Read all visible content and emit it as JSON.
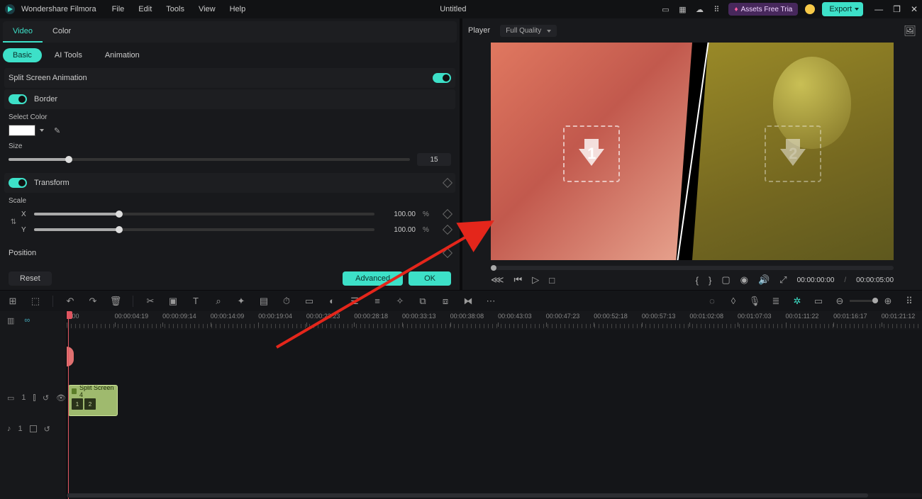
{
  "app": {
    "brand": "Wondershare Filmora",
    "doc_title": "Untitled"
  },
  "menus": [
    "File",
    "Edit",
    "Tools",
    "View",
    "Help"
  ],
  "titlebar": {
    "assets_label": "Assets Free Tria",
    "export_label": "Export"
  },
  "inspector": {
    "tabs": [
      "Video",
      "Color"
    ],
    "active_tab": 0,
    "subtabs": [
      "Basic",
      "AI Tools",
      "Animation"
    ],
    "active_subtab": 0,
    "split_anim_label": "Split Screen Animation",
    "border_label": "Border",
    "select_color_label": "Select Color",
    "select_color_value": "#FFFFFF",
    "size_label": "Size",
    "size_value": "15",
    "size_pct": 15,
    "transform_label": "Transform",
    "scale_label": "Scale",
    "scale_x_label": "X",
    "scale_x_value": "100.00",
    "scale_x_unit": "%",
    "scale_y_label": "Y",
    "scale_y_value": "100.00",
    "scale_y_unit": "%",
    "position_label": "Position",
    "reset_label": "Reset",
    "advanced_label": "Advanced",
    "ok_label": "OK"
  },
  "player": {
    "label": "Player",
    "quality_label": "Full Quality",
    "drop1": "1",
    "drop2": "2",
    "tc_current": "00:00:00:00",
    "tc_total": "00:00:05:00"
  },
  "ruler_labels": [
    "0:00",
    "00:00:04:19",
    "00:00:09:14",
    "00:00:14:09",
    "00:00:19:04",
    "00:00:23:23",
    "00:00:28:18",
    "00:00:33:13",
    "00:00:38:08",
    "00:00:43:03",
    "00:00:47:23",
    "00:00:52:18",
    "00:00:57:13",
    "00:01:02:08",
    "00:01:07:03",
    "00:01:11:22",
    "00:01:16:17",
    "00:01:21:12"
  ],
  "clip": {
    "name": "Split Screen 4",
    "thumbs": [
      "1",
      "2"
    ]
  }
}
